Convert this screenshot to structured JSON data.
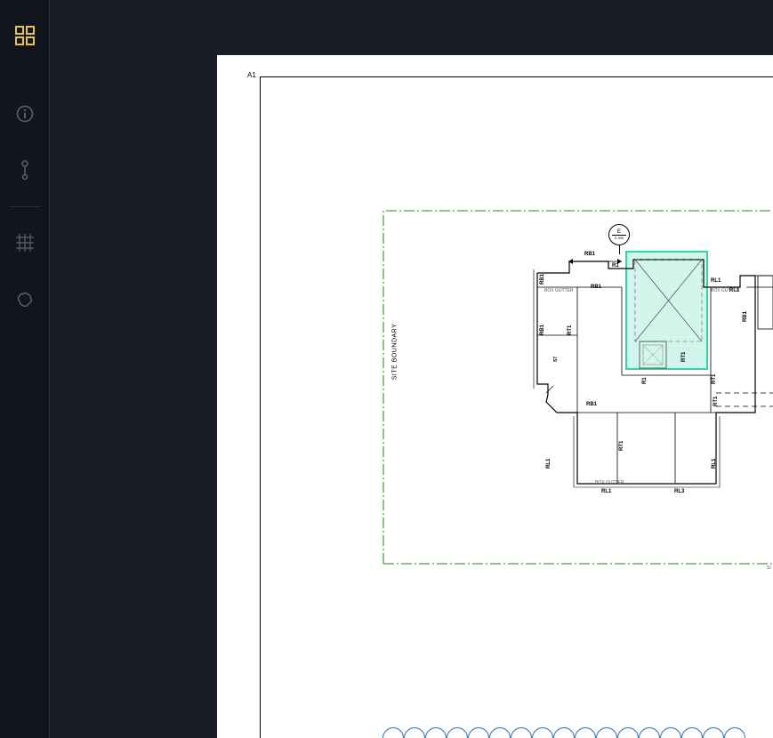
{
  "sidebar": {
    "items": [
      {
        "name": "apps-icon",
        "active": true
      },
      {
        "name": "info-icon",
        "active": false
      },
      {
        "name": "dots-icon",
        "active": false
      },
      {
        "name": "grid-icon",
        "active": false
      },
      {
        "name": "hand-icon",
        "active": false
      }
    ]
  },
  "sheet": {
    "corner_label": "A1",
    "site_boundary_label": "SITE BOUNDARY",
    "site_label_right": "SI"
  },
  "plan": {
    "detail_ref_top": "E",
    "detail_ref_bottom": "S.300",
    "labels": {
      "rb1_top": "RB1",
      "r1_top": "R1",
      "rb1_left1": "RB1",
      "rb1_left2": "RB1",
      "s7": "S7",
      "box_gutter_top": "BOX GUTTER",
      "box_gutter_right": "BOX GUTTER",
      "box_gutter_bottom": "BOX GUTTER",
      "rb1_mid": "RB1",
      "rl1_top": "RL1",
      "rl1_top2": "RL1",
      "rb1_right": "RB1",
      "rt1_1": "RT1",
      "rt1_2": "RT1",
      "rt1_3": "RT1",
      "r1_mid": "R1",
      "rb1_lower": "RB1",
      "rt1_right": "RT1",
      "rl1_left": "RL1",
      "rt1_mid": "RT1",
      "rl1_right": "RL1",
      "rl1_bottom": "RL1",
      "rl3_bottom": "RL3"
    }
  }
}
